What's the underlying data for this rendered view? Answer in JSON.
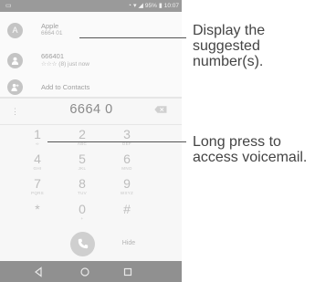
{
  "status_bar": {
    "time": "10:07",
    "battery": "95%"
  },
  "suggestions": [
    {
      "avatar": "A",
      "title": "Apple",
      "subtitle": "6664 01"
    },
    {
      "avatar": "person-icon",
      "title": "666401",
      "subtitle": "☆☆☆ (8) just now"
    },
    {
      "avatar": "person-add-icon",
      "title": "Add to Contacts",
      "subtitle": ""
    }
  ],
  "dialer": {
    "number": "6664 0",
    "keys": [
      {
        "digit": "1",
        "letters": "∞"
      },
      {
        "digit": "2",
        "letters": "ABC"
      },
      {
        "digit": "3",
        "letters": "DEF"
      },
      {
        "digit": "4",
        "letters": "GHI"
      },
      {
        "digit": "5",
        "letters": "JKL"
      },
      {
        "digit": "6",
        "letters": "MNO"
      },
      {
        "digit": "7",
        "letters": "PQRS"
      },
      {
        "digit": "8",
        "letters": "TUV"
      },
      {
        "digit": "9",
        "letters": "WXYZ"
      },
      {
        "digit": "*",
        "letters": ""
      },
      {
        "digit": "0",
        "letters": "+"
      },
      {
        "digit": "#",
        "letters": ""
      }
    ],
    "hide_label": "Hide"
  },
  "callouts": {
    "suggested": [
      "Display the",
      "suggested",
      "number(s)."
    ],
    "voicemail": [
      "Long press to",
      "access voicemail."
    ]
  },
  "colors": {
    "status_bar": "#9a9a9a",
    "nav_bar": "#909090",
    "callout_text": "#444444"
  }
}
